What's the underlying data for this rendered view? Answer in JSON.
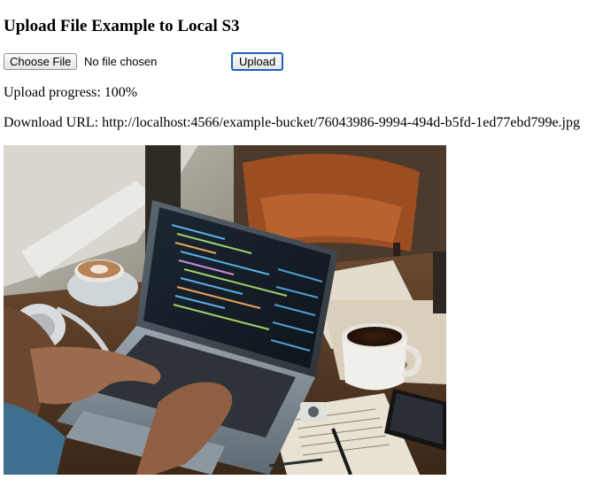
{
  "page": {
    "title": "Upload File Example to Local S3"
  },
  "form": {
    "choose_file_label": "Choose File",
    "file_status": "No file chosen",
    "upload_label": "Upload"
  },
  "progress": {
    "label": "Upload progress: 100%",
    "value": 1.0
  },
  "download": {
    "label": "Download URL: http://localhost:4566/example-bucket/76043986-9994-494d-b5fd-1ed77ebd799e.jpg"
  },
  "image": {
    "subject": "laptop-coding-cafe-photo"
  }
}
